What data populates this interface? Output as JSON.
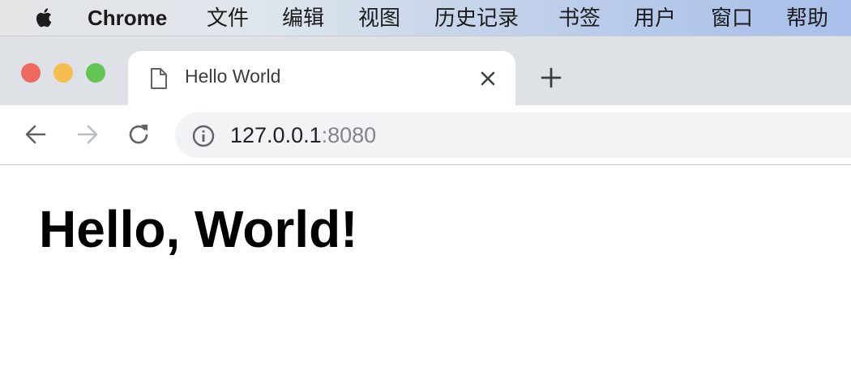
{
  "menubar": {
    "apple_icon": "apple-logo-icon",
    "app_name": "Chrome",
    "items": [
      "文件",
      "编辑",
      "视图",
      "历史记录",
      "书签",
      "用户",
      "窗口",
      "帮助"
    ]
  },
  "window": {
    "traffic_lights": {
      "close_color": "#ee6a5f",
      "minimize_color": "#f5be4f",
      "zoom_color": "#62c554"
    }
  },
  "tab": {
    "title": "Hello World",
    "icon": "document-icon",
    "close_icon": "close-icon"
  },
  "new_tab_icon": "plus-icon",
  "toolbar": {
    "back_icon": "back-arrow-icon",
    "forward_icon": "forward-arrow-icon",
    "reload_icon": "reload-icon",
    "info_icon": "info-icon"
  },
  "address": {
    "host": "127.0.0.1",
    "port": ":8080"
  },
  "page": {
    "heading": "Hello, World!"
  }
}
